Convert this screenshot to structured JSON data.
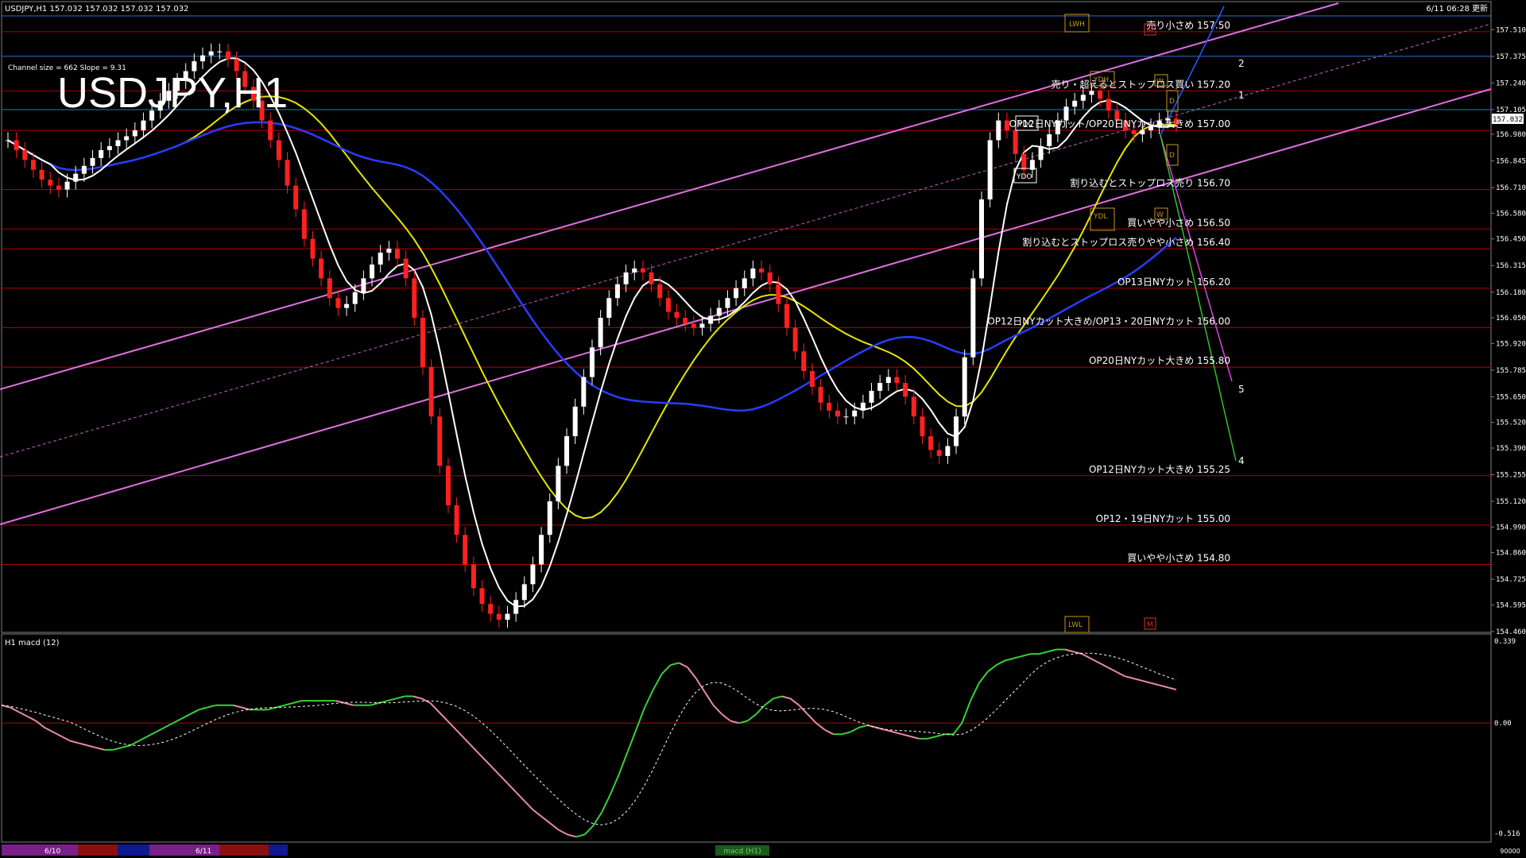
{
  "header": {
    "symbol_info": "USDJPY,H1  157.032 157.032 157.032 157.032",
    "updated": "6/11 06:28 更新",
    "big_title": "USDJPY,H1",
    "channel_info": "Channel size = 662  Slope = 9.31"
  },
  "subwindow": {
    "title": "H1  macd (12)"
  },
  "bottom_bar": {
    "dates": [
      "6/10",
      "6/11"
    ],
    "label": "macd (H1)",
    "right_value": "90000"
  },
  "badges": {
    "lwh": "LWH",
    "ydh": "YDH",
    "ydc": "YDC",
    "ydo": "YDO",
    "ydl": "YDL",
    "lwl": "LWL",
    "m": "M",
    "w": "W",
    "d": "D"
  },
  "colors": {
    "background": "#000000",
    "level_line": "#b00000",
    "level_text": "#ffffff",
    "price_tag_bg": "#ffffff",
    "macd_up": "#39d039",
    "macd_down": "#e88aa8",
    "pivot_label": "#ffffff",
    "badge": "#c8961e"
  },
  "chart_data": {
    "type": "line",
    "title": "USDJPY,H1",
    "ylim": [
      154.46,
      157.58
    ],
    "y_ticks": [
      "157.510",
      "157.375",
      "157.240",
      "157.105",
      "156.980",
      "156.845",
      "156.710",
      "156.580",
      "156.450",
      "156.315",
      "156.180",
      "156.050",
      "155.920",
      "155.785",
      "155.650",
      "155.520",
      "155.390",
      "155.255",
      "155.120",
      "154.990",
      "154.860",
      "154.725",
      "154.595",
      "154.460"
    ],
    "current_price": "157.032",
    "levels": [
      {
        "label": "売り小さめ 157.50",
        "price": 157.5
      },
      {
        "label": "売り・超えるとストップロス買い 157.20",
        "price": 157.2
      },
      {
        "label": "OP12日NYカット/OP20日NYカット大きめ 157.00",
        "price": 157.0
      },
      {
        "label": "割り込むとストップロス売り 156.70",
        "price": 156.7
      },
      {
        "label": "買いやや小さめ 156.50",
        "price": 156.5
      },
      {
        "label": "割り込むとストップロス売りやや小さめ 156.40",
        "price": 156.4
      },
      {
        "label": "OP13日NYカット 156.20",
        "price": 156.2
      },
      {
        "label": "OP12日NYカット大きめ/OP13・20日NYカット 156.00",
        "price": 156.0
      },
      {
        "label": "OP20日NYカット大きめ 155.80",
        "price": 155.8
      },
      {
        "label": "OP12日NYカット大きめ 155.25",
        "price": 155.25
      },
      {
        "label": "OP12・19日NYカット 155.00",
        "price": 155.0
      },
      {
        "label": "買いやや小さめ 154.80",
        "price": 154.8
      }
    ],
    "pivot_marks": [
      "1",
      "2",
      "5",
      "4"
    ],
    "candles_close": [
      156.95,
      156.9,
      156.85,
      156.8,
      156.75,
      156.72,
      156.7,
      156.74,
      156.78,
      156.82,
      156.86,
      156.9,
      156.92,
      156.95,
      156.97,
      157.0,
      157.05,
      157.1,
      157.15,
      157.2,
      157.25,
      157.3,
      157.35,
      157.38,
      157.4,
      157.4,
      157.36,
      157.3,
      157.22,
      157.15,
      157.05,
      156.95,
      156.85,
      156.72,
      156.6,
      156.45,
      156.35,
      156.25,
      156.15,
      156.1,
      156.12,
      156.18,
      156.25,
      156.32,
      156.38,
      156.4,
      156.35,
      156.25,
      156.05,
      155.8,
      155.55,
      155.3,
      155.1,
      154.95,
      154.8,
      154.68,
      154.6,
      154.55,
      154.52,
      154.55,
      154.62,
      154.7,
      154.8,
      154.95,
      155.12,
      155.3,
      155.45,
      155.6,
      155.75,
      155.9,
      156.05,
      156.15,
      156.22,
      156.28,
      156.3,
      156.28,
      156.22,
      156.15,
      156.08,
      156.05,
      156.02,
      156.0,
      156.02,
      156.06,
      156.1,
      156.15,
      156.2,
      156.25,
      156.3,
      156.28,
      156.22,
      156.12,
      156.0,
      155.88,
      155.78,
      155.7,
      155.62,
      155.58,
      155.55,
      155.55,
      155.58,
      155.62,
      155.68,
      155.72,
      155.75,
      155.72,
      155.65,
      155.55,
      155.45,
      155.38,
      155.35,
      155.4,
      155.55,
      155.85,
      156.25,
      156.65,
      156.95,
      157.05,
      157.0,
      156.88,
      156.8,
      156.85,
      156.92,
      156.98,
      157.05,
      157.12,
      157.15,
      157.18,
      157.2,
      157.16,
      157.1,
      157.05,
      157.0,
      156.98,
      157.0,
      157.02,
      157.05,
      157.06,
      157.03
    ],
    "macd_values": [
      0.08,
      0.07,
      0.05,
      0.03,
      0.01,
      -0.02,
      -0.04,
      -0.06,
      -0.08,
      -0.09,
      -0.1,
      -0.11,
      -0.12,
      -0.12,
      -0.11,
      -0.1,
      -0.08,
      -0.06,
      -0.04,
      -0.02,
      0.0,
      0.02,
      0.04,
      0.06,
      0.07,
      0.08,
      0.08,
      0.08,
      0.07,
      0.06,
      0.06,
      0.06,
      0.07,
      0.08,
      0.09,
      0.1,
      0.1,
      0.1,
      0.1,
      0.1,
      0.09,
      0.08,
      0.08,
      0.08,
      0.09,
      0.1,
      0.11,
      0.12,
      0.12,
      0.11,
      0.09,
      0.05,
      0.01,
      -0.03,
      -0.07,
      -0.11,
      -0.15,
      -0.19,
      -0.23,
      -0.27,
      -0.31,
      -0.35,
      -0.39,
      -0.42,
      -0.45,
      -0.48,
      -0.5,
      -0.51,
      -0.5,
      -0.46,
      -0.4,
      -0.32,
      -0.23,
      -0.13,
      -0.03,
      0.07,
      0.15,
      0.22,
      0.26,
      0.27,
      0.25,
      0.2,
      0.14,
      0.08,
      0.04,
      0.01,
      0.0,
      0.01,
      0.04,
      0.08,
      0.11,
      0.12,
      0.11,
      0.08,
      0.04,
      0.0,
      -0.03,
      -0.05,
      -0.05,
      -0.04,
      -0.02,
      -0.01,
      -0.02,
      -0.03,
      -0.04,
      -0.05,
      -0.06,
      -0.07,
      -0.07,
      -0.06,
      -0.05,
      -0.05,
      0.0,
      0.1,
      0.18,
      0.23,
      0.26,
      0.28,
      0.29,
      0.3,
      0.31,
      0.31,
      0.32,
      0.33,
      0.33,
      0.32,
      0.31,
      0.29,
      0.27,
      0.25,
      0.23,
      0.21,
      0.2,
      0.19,
      0.18,
      0.17,
      0.16,
      0.15
    ],
    "macd_ylim": [
      -0.516,
      0.339
    ],
    "macd_ticks": [
      "0.339",
      "0.00",
      "-0.516"
    ]
  }
}
